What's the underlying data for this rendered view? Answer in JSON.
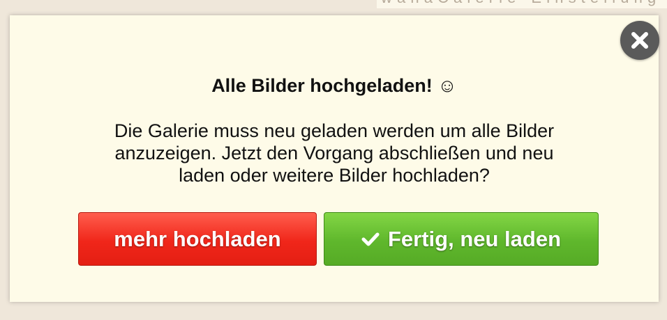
{
  "background": {
    "partial_text": "w a h a  C a l e r i e   ▪  E i n s t e l l u n g"
  },
  "dialog": {
    "title": "Alle Bilder hochgeladen! ☺",
    "message_lines": [
      "Die Galerie muss neu geladen werden um alle Bilder",
      "anzuzeigen. Jetzt den Vorgang abschließen und neu",
      "laden oder weitere Bilder hochladen?"
    ],
    "buttons": {
      "more_upload": "mehr hochladen",
      "done_reload": "Fertig, neu laden"
    },
    "close_icon": "close-x-icon",
    "check_icon": "checkmark-icon"
  },
  "colors": {
    "dialog_bg": "#fefbe8",
    "red_button": "#f0261a",
    "green_button": "#5fb72c",
    "close_button": "#5a5a5a"
  }
}
